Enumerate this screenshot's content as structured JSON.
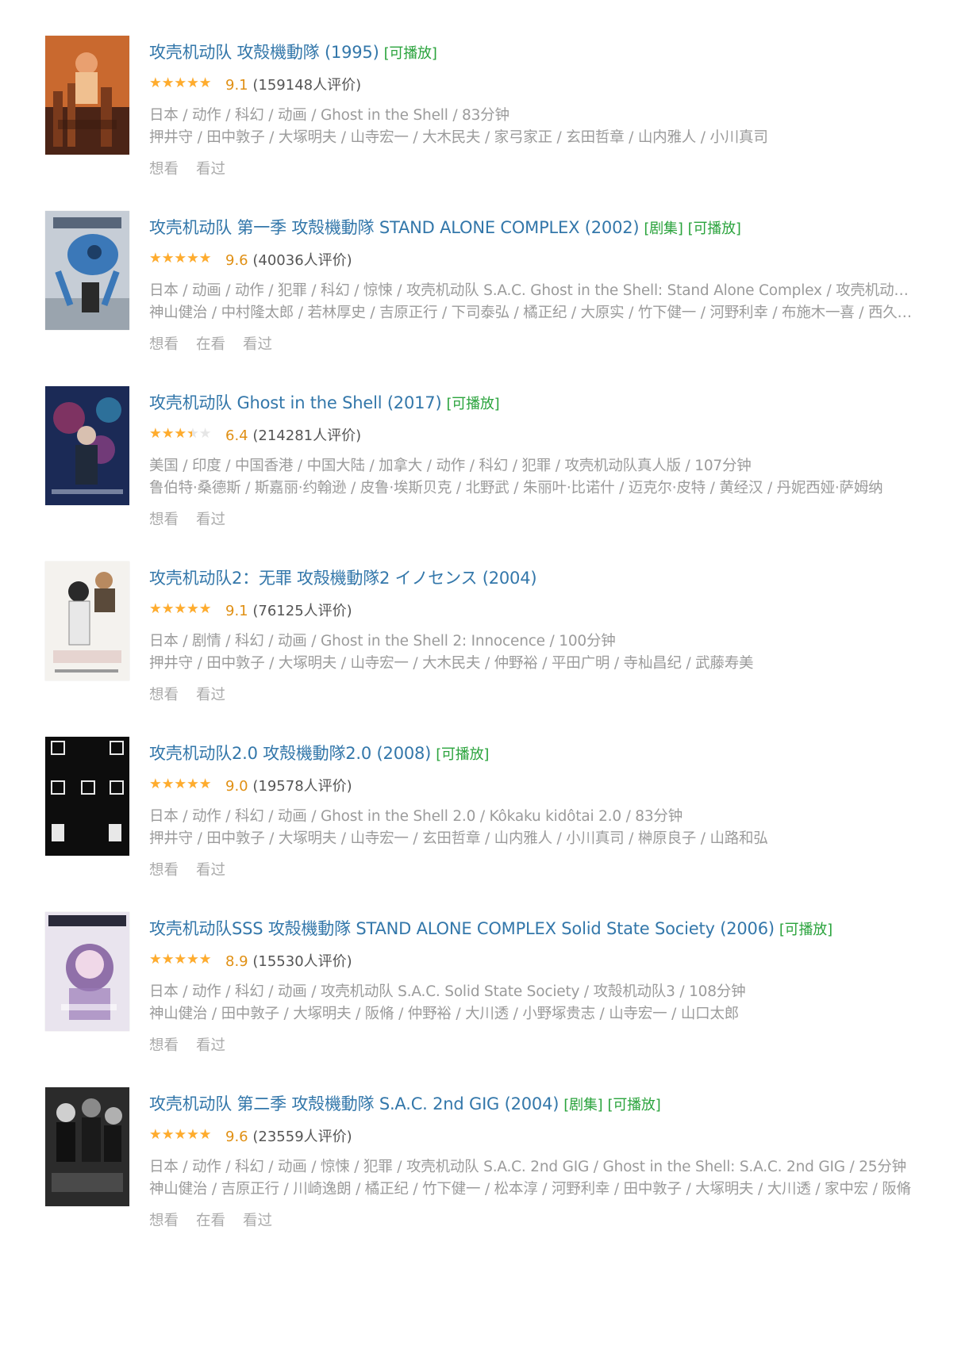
{
  "colors": {
    "title": "#3377aa",
    "tag": "#2aa33c",
    "star": "#ffac2d",
    "score": "#e09015",
    "meta": "#9b9b9b"
  },
  "items": [
    {
      "title": "攻壳机动队 攻殻機動隊 (1995)",
      "tags": [
        "[可播放]"
      ],
      "rating_fraction": 0.9,
      "score": "9.1",
      "votes": "(159148人评价)",
      "meta1": "日本 / 动作 / 科幻 / 动画 / Ghost in the Shell / 83分钟",
      "meta2": "押井守 / 田中敦子 / 大塚明夫 / 山寺宏一 / 大木民夫 / 家弓家正 / 玄田哲章 / 山内雅人 / 小川真司",
      "actions": [
        "想看",
        "看过"
      ],
      "poster_icon": "poster-ghost-in-the-shell-1995",
      "poster_colors": [
        "#c9692f",
        "#4b2416"
      ]
    },
    {
      "title": "攻壳机动队 第一季 攻殻機動隊 STAND ALONE COMPLEX (2002)",
      "tags": [
        "[剧集]",
        "[可播放]"
      ],
      "rating_fraction": 1.0,
      "score": "9.6",
      "votes": "(40036人评价)",
      "meta1": "日本 / 动画 / 动作 / 犯罪 / 科幻 / 惊悚 / 攻壳机动队 S.A.C. Ghost in the Shell: Stand Alone Complex / 攻壳机动队：独立行动组",
      "meta2": "神山健治 / 中村隆太郎 / 若林厚史 / 吉原正行 / 下司泰弘 / 橘正纪 / 大原实 / 竹下健一 / 河野利幸 / 布施木一喜 / 西久保利彦",
      "actions": [
        "想看",
        "在看",
        "看过"
      ],
      "poster_icon": "poster-stand-alone-complex",
      "poster_colors": [
        "#c6cdd6",
        "#3b78b8"
      ]
    },
    {
      "title": "攻壳机动队 Ghost in the Shell (2017)",
      "tags": [
        "[可播放]"
      ],
      "rating_fraction": 0.6,
      "score": "6.4",
      "votes": "(214281人评价)",
      "meta1": "美国 / 印度 / 中国香港 / 中国大陆 / 加拿大 / 动作 / 科幻 / 犯罪 / 攻壳机动队真人版 / 107分钟",
      "meta2": "鲁伯特·桑德斯 / 斯嘉丽·约翰逊 / 皮鲁·埃斯贝克 / 北野武 / 朱丽叶·比诺什 / 迈克尔·皮特 / 黄经汉 / 丹妮西娅·萨姆纳",
      "actions": [
        "想看",
        "看过"
      ],
      "poster_icon": "poster-ghost-in-the-shell-2017",
      "poster_colors": [
        "#1b2a56",
        "#c23a6b"
      ]
    },
    {
      "title": "攻壳机动队2：无罪 攻殻機動隊2 イノセンス (2004)",
      "tags": [],
      "rating_fraction": 0.9,
      "score": "9.1",
      "votes": "(76125人评价)",
      "meta1": "日本 / 剧情 / 科幻 / 动画 / Ghost in the Shell 2: Innocence / 100分钟",
      "meta2": "押井守 / 田中敦子 / 大塚明夫 / 山寺宏一 / 大木民夫 / 仲野裕 / 平田广明 / 寺杣昌纪 / 武藤寿美",
      "actions": [
        "想看",
        "看过"
      ],
      "poster_icon": "poster-innocence",
      "poster_colors": [
        "#f4f2ee",
        "#9a2a2a"
      ]
    },
    {
      "title": "攻壳机动队2.0 攻殻機動隊2.0 (2008)",
      "tags": [
        "[可播放]"
      ],
      "rating_fraction": 0.9,
      "score": "9.0",
      "votes": "(19578人评价)",
      "meta1": "日本 / 动作 / 科幻 / 动画 / Ghost in the Shell 2.0 / Kôkaku kidôtai 2.0 / 83分钟",
      "meta2": "押井守 / 田中敦子 / 大塚明夫 / 山寺宏一 / 玄田哲章 / 山内雅人 / 小川真司 / 榊原良子 / 山路和弘",
      "actions": [
        "想看",
        "看过"
      ],
      "poster_icon": "poster-ghost-in-the-shell-2-0",
      "poster_colors": [
        "#0d0d0d",
        "#e8e8e8"
      ]
    },
    {
      "title": "攻壳机动队SSS 攻殻機動隊 STAND ALONE COMPLEX Solid State Society (2006)",
      "tags": [
        "[可播放]"
      ],
      "rating_fraction": 0.9,
      "score": "8.9",
      "votes": "(15530人评价)",
      "meta1": "日本 / 动作 / 科幻 / 动画 / 攻壳机动队 S.A.C. Solid State Society / 攻殻机动队3 / 108分钟",
      "meta2": "神山健治 / 田中敦子 / 大塚明夫 / 阪脩 / 仲野裕 / 大川透 / 小野塚贵志 / 山寺宏一 / 山口太郎",
      "actions": [
        "想看",
        "看过"
      ],
      "poster_icon": "poster-solid-state-society",
      "poster_colors": [
        "#e9e4ee",
        "#6a3f8c"
      ]
    },
    {
      "title": "攻壳机动队 第二季 攻殻機動隊 S.A.C. 2nd GIG (2004)",
      "tags": [
        "[剧集]",
        "[可播放]"
      ],
      "rating_fraction": 1.0,
      "score": "9.6",
      "votes": "(23559人评价)",
      "meta1": "日本 / 动作 / 科幻 / 动画 / 惊悚 / 犯罪 / 攻壳机动队 S.A.C. 2nd GIG / Ghost in the Shell: S.A.C. 2nd GIG / 25分钟",
      "meta2": "神山健治 / 吉原正行 / 川崎逸朗 / 橘正纪 / 竹下健一 / 松本淳 / 河野利幸 / 田中敦子 / 大塚明夫 / 大川透 / 家中宏 / 阪脩",
      "actions": [
        "想看",
        "在看",
        "看过"
      ],
      "poster_icon": "poster-2nd-gig",
      "poster_colors": [
        "#2b2b2b",
        "#cfcfcf"
      ]
    }
  ]
}
